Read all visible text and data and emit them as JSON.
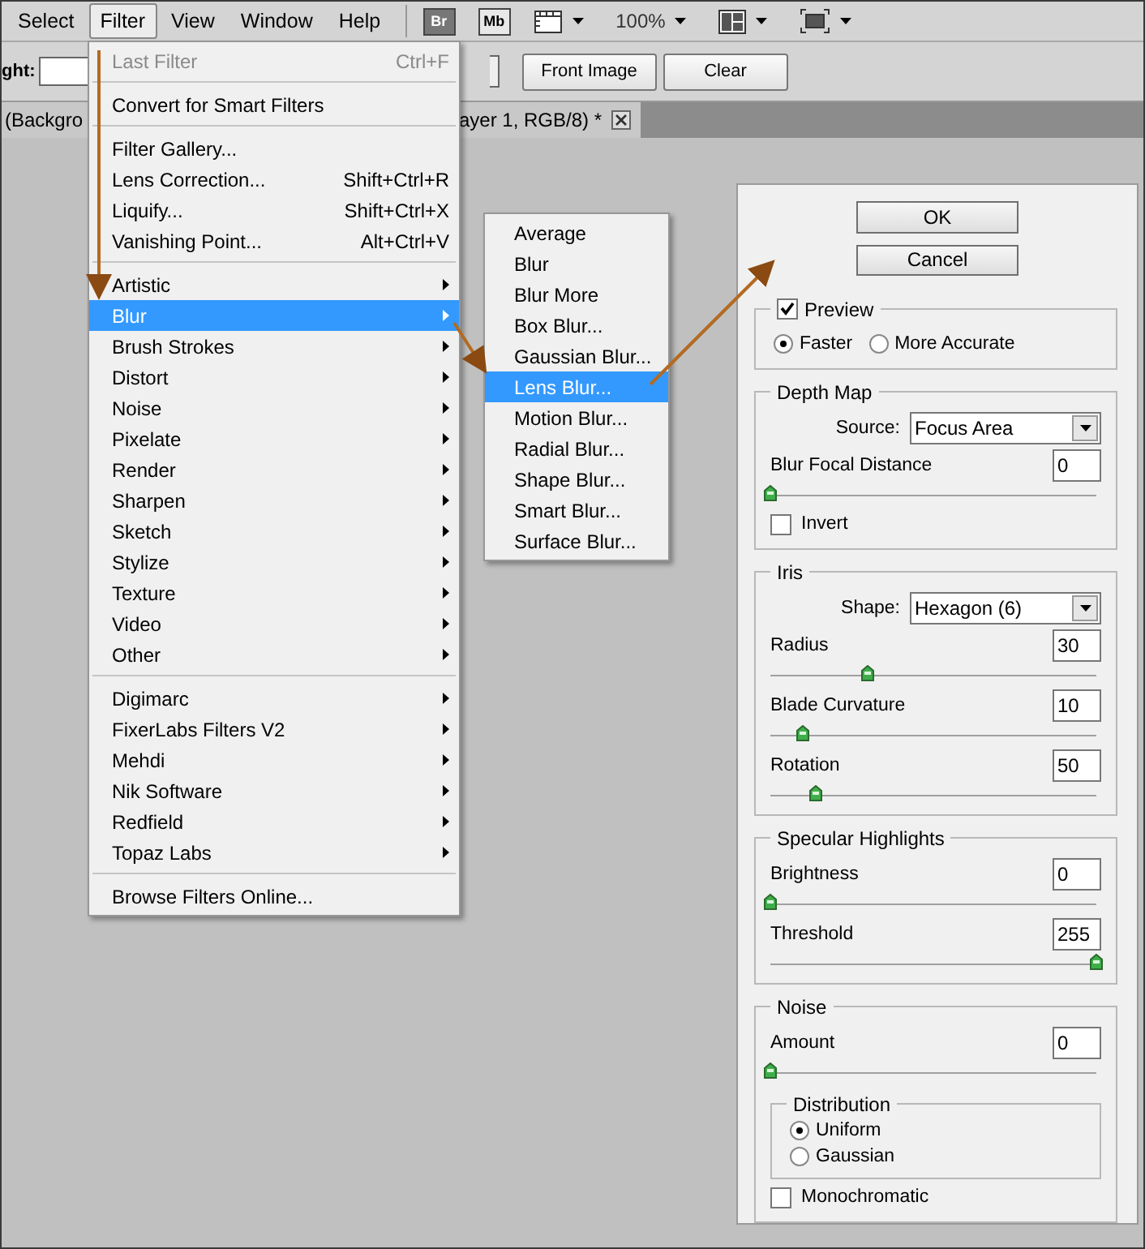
{
  "menubar": {
    "items": [
      {
        "label": "Select",
        "selected": false
      },
      {
        "label": "Filter",
        "selected": true
      },
      {
        "label": "View",
        "selected": false
      },
      {
        "label": "Window",
        "selected": false
      },
      {
        "label": "Help",
        "selected": false
      }
    ],
    "tools": [
      {
        "kind": "app",
        "label": "Br",
        "filled": true
      },
      {
        "kind": "app",
        "label": "Mb",
        "filled": false
      },
      {
        "kind": "extras"
      },
      {
        "kind": "zoom",
        "label": "100%"
      },
      {
        "kind": "arrange"
      },
      {
        "kind": "screen"
      }
    ]
  },
  "options_bar": {
    "field_label": "ght:",
    "buttons": [
      "Front Image",
      "Clear"
    ]
  },
  "tabs": [
    {
      "label": "(Backgro"
    },
    {
      "label": "ayer 1, RGB/8) *",
      "closable": true
    }
  ],
  "filter_menu": {
    "sections": [
      [
        {
          "label": "Last Filter",
          "shortcut": "Ctrl+F",
          "disabled": true,
          "submenu": false,
          "selected": false
        }
      ],
      [
        {
          "label": "Convert for Smart Filters",
          "disabled": false,
          "submenu": false,
          "selected": false
        }
      ],
      [
        {
          "label": "Filter Gallery...",
          "disabled": false,
          "submenu": false,
          "selected": false
        },
        {
          "label": "Lens Correction...",
          "shortcut": "Shift+Ctrl+R",
          "disabled": false,
          "submenu": false,
          "selected": false
        },
        {
          "label": "Liquify...",
          "shortcut": "Shift+Ctrl+X",
          "disabled": false,
          "submenu": false,
          "selected": false
        },
        {
          "label": "Vanishing Point...",
          "shortcut": "Alt+Ctrl+V",
          "disabled": false,
          "submenu": false,
          "selected": false
        }
      ],
      [
        {
          "label": "Artistic",
          "disabled": false,
          "submenu": true,
          "selected": false
        },
        {
          "label": "Blur",
          "disabled": false,
          "submenu": true,
          "selected": true
        },
        {
          "label": "Brush Strokes",
          "disabled": false,
          "submenu": true,
          "selected": false
        },
        {
          "label": "Distort",
          "disabled": false,
          "submenu": true,
          "selected": false
        },
        {
          "label": "Noise",
          "disabled": false,
          "submenu": true,
          "selected": false
        },
        {
          "label": "Pixelate",
          "disabled": false,
          "submenu": true,
          "selected": false
        },
        {
          "label": "Render",
          "disabled": false,
          "submenu": true,
          "selected": false
        },
        {
          "label": "Sharpen",
          "disabled": false,
          "submenu": true,
          "selected": false
        },
        {
          "label": "Sketch",
          "disabled": false,
          "submenu": true,
          "selected": false
        },
        {
          "label": "Stylize",
          "disabled": false,
          "submenu": true,
          "selected": false
        },
        {
          "label": "Texture",
          "disabled": false,
          "submenu": true,
          "selected": false
        },
        {
          "label": "Video",
          "disabled": false,
          "submenu": true,
          "selected": false
        },
        {
          "label": "Other",
          "disabled": false,
          "submenu": true,
          "selected": false
        }
      ],
      [
        {
          "label": "Digimarc",
          "disabled": false,
          "submenu": true,
          "selected": false
        },
        {
          "label": "FixerLabs Filters V2",
          "disabled": false,
          "submenu": true,
          "selected": false
        },
        {
          "label": "Mehdi",
          "disabled": false,
          "submenu": true,
          "selected": false
        },
        {
          "label": "Nik Software",
          "disabled": false,
          "submenu": true,
          "selected": false
        },
        {
          "label": "Redfield",
          "disabled": false,
          "submenu": true,
          "selected": false
        },
        {
          "label": "Topaz Labs",
          "disabled": false,
          "submenu": true,
          "selected": false
        }
      ],
      [
        {
          "label": "Browse Filters Online...",
          "disabled": false,
          "submenu": false,
          "selected": false
        }
      ]
    ]
  },
  "blur_menu": {
    "items": [
      {
        "label": "Average",
        "selected": false
      },
      {
        "label": "Blur",
        "selected": false
      },
      {
        "label": "Blur More",
        "selected": false
      },
      {
        "label": "Box Blur...",
        "selected": false
      },
      {
        "label": "Gaussian Blur...",
        "selected": false
      },
      {
        "label": "Lens Blur...",
        "selected": true
      },
      {
        "label": "Motion Blur...",
        "selected": false
      },
      {
        "label": "Radial Blur...",
        "selected": false
      },
      {
        "label": "Shape Blur...",
        "selected": false
      },
      {
        "label": "Smart Blur...",
        "selected": false
      },
      {
        "label": "Surface Blur...",
        "selected": false
      }
    ]
  },
  "dialog": {
    "buttons": [
      "OK",
      "Cancel"
    ],
    "groups": [
      {
        "title": "Preview",
        "kind": "checkbox-legend",
        "checked": true,
        "controls": [
          {
            "kind": "radio-row",
            "options": [
              {
                "label": "Faster",
                "selected": true
              },
              {
                "label": "More Accurate",
                "selected": false
              }
            ]
          }
        ]
      },
      {
        "title": "Depth Map",
        "kind": "plain",
        "controls": [
          {
            "kind": "select",
            "label": "Source:",
            "value": "Focus Area"
          },
          {
            "kind": "slider",
            "label": "Blur Focal Distance",
            "value": "0",
            "level": 0
          },
          {
            "kind": "checkbox",
            "label": "Invert",
            "checked": false
          }
        ]
      },
      {
        "title": "Iris",
        "kind": "plain",
        "controls": [
          {
            "kind": "select",
            "label": "Shape:",
            "value": "Hexagon (6)"
          },
          {
            "kind": "slider",
            "label": "Radius",
            "value": "30",
            "level": 0.3
          },
          {
            "kind": "slider",
            "label": "Blade Curvature",
            "value": "10",
            "level": 0.1
          },
          {
            "kind": "slider",
            "label": "Rotation",
            "value": "50",
            "level": 0.14
          }
        ]
      },
      {
        "title": "Specular Highlights",
        "kind": "plain",
        "controls": [
          {
            "kind": "slider",
            "label": "Brightness",
            "value": "0",
            "level": 0
          },
          {
            "kind": "slider",
            "label": "Threshold",
            "value": "255",
            "level": 1
          }
        ]
      },
      {
        "title": "Noise",
        "kind": "plain",
        "controls": [
          {
            "kind": "slider",
            "label": "Amount",
            "value": "0",
            "level": 0
          },
          {
            "kind": "radio-group",
            "title": "Distribution",
            "options": [
              {
                "label": "Uniform",
                "selected": true
              },
              {
                "label": "Gaussian",
                "selected": false
              }
            ]
          },
          {
            "kind": "checkbox",
            "label": "Monochromatic",
            "checked": false
          }
        ]
      }
    ]
  }
}
